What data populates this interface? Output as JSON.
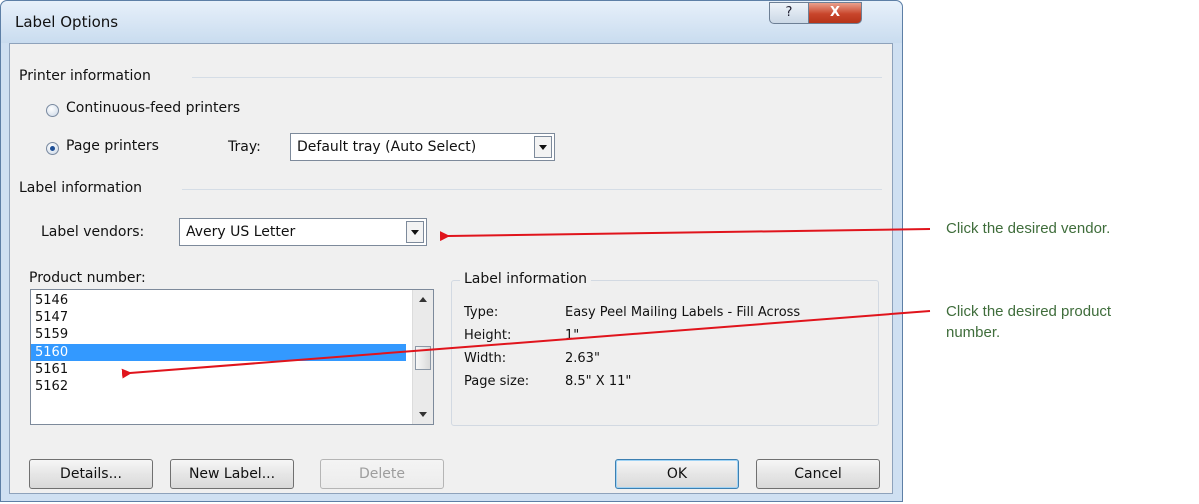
{
  "window": {
    "title": "Label Options",
    "help_glyph": "?",
    "close_glyph": "X"
  },
  "printer_info": {
    "section_label": "Printer information",
    "continuous_feed": {
      "label": "Continuous-feed printers",
      "selected": false
    },
    "page_printers": {
      "label": "Page printers",
      "selected": true
    },
    "tray_label": "Tray:",
    "tray_value": "Default tray (Auto Select)"
  },
  "label_info": {
    "section_label": "Label information",
    "vendors_label": "Label vendors:",
    "vendors_value": "Avery US Letter"
  },
  "product_number": {
    "label": "Product number:",
    "items": [
      "5146",
      "5147",
      "5159",
      "5160",
      "5161",
      "5162"
    ],
    "selected": "5160"
  },
  "details_group": {
    "title": "Label information",
    "rows": [
      {
        "key": "Type:",
        "value": "Easy Peel Mailing Labels - Fill Across"
      },
      {
        "key": "Height:",
        "value": "1\""
      },
      {
        "key": "Width:",
        "value": "2.63\""
      },
      {
        "key": "Page size:",
        "value": "8.5\" X 11\""
      }
    ]
  },
  "buttons": {
    "details": "Details...",
    "new_label": "New Label...",
    "delete": "Delete",
    "ok": "OK",
    "cancel": "Cancel"
  },
  "annotations": {
    "vendor": "Click the desired vendor.",
    "product_line1": "Click the desired product",
    "product_line2": "number."
  },
  "colors": {
    "selection": "#3399ff",
    "annotation_text": "#3f6d3b",
    "arrow": "#e0141c"
  }
}
